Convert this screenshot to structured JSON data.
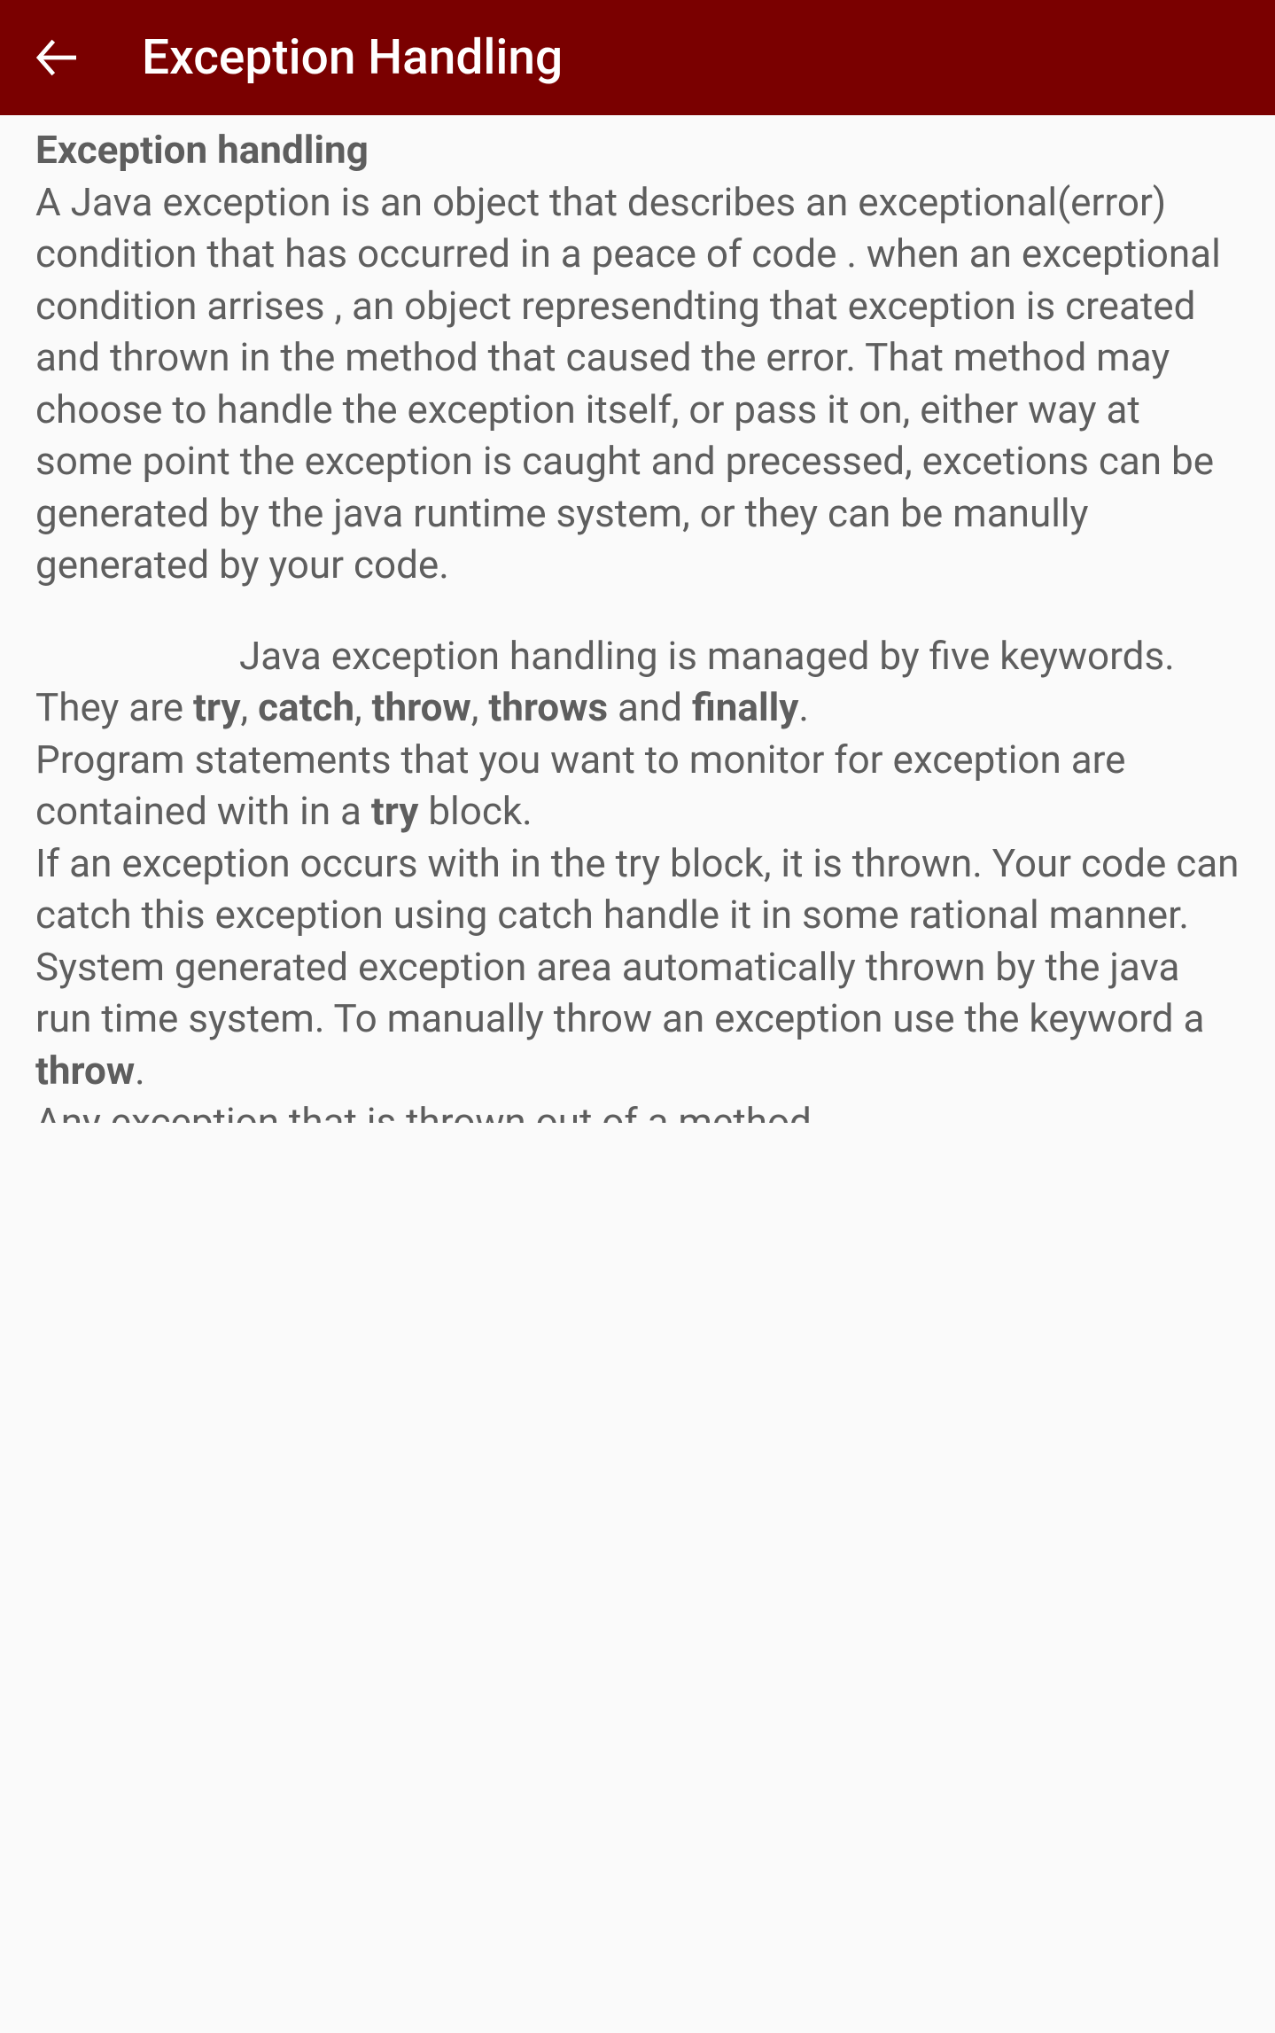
{
  "header": {
    "title": "Exception Handling"
  },
  "content": {
    "heading": "Exception handling",
    "para1": "A Java exception is an object that describes an exceptional(error) condition that has occurred in a peace of code . when an exceptional condition arrises , an object represendting that exception is created and thrown in the method that caused the error. That method may choose to handle the exception itself, or pass it on, either way at some point the exception is caught and precessed, excetions can be generated by the java runtime system, or they can be manully generated by your code.",
    "para2_pre": "Java exception handling is managed by five keywords. They are ",
    "kw_try": "try",
    "comma1": ", ",
    "kw_catch": "catch",
    "comma2": ", ",
    "kw_throw": "throw",
    "comma3": ", ",
    "kw_throws": "throws",
    "and": " and ",
    "kw_finally": "finally",
    "period": ".",
    "para3_pre": "Program statements that you want to monitor for exception are contained with in a ",
    "para3_bold": "try",
    "para3_post": " block.",
    "para4_pre": "If an exception occurs with in the try block, it is thrown. Your code can catch this exception using catch handle it in some rational manner. System generated exception area automatically thrown by the java run time system. To manually throw an exception use the keyword a ",
    "para4_bold": "throw",
    "para4_post": ".",
    "partial": "Any exception that is thrown out of a method"
  }
}
